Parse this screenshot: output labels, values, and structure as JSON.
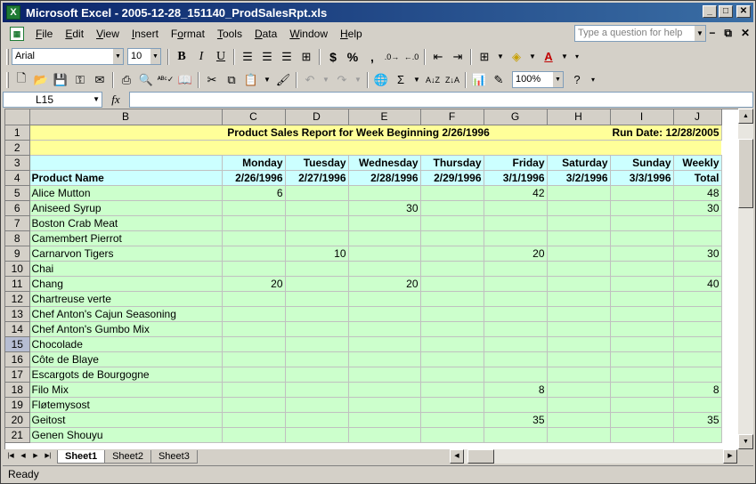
{
  "window": {
    "title": "Microsoft Excel - 2005-12-28_151140_ProdSalesRpt.xls",
    "app_icon": "X"
  },
  "menu": {
    "items": [
      {
        "u": "F",
        "rest": "ile"
      },
      {
        "u": "E",
        "rest": "dit"
      },
      {
        "u": "V",
        "rest": "iew"
      },
      {
        "u": "I",
        "rest": "nsert"
      },
      {
        "pre": "F",
        "u": "o",
        "rest": "rmat"
      },
      {
        "u": "T",
        "rest": "ools"
      },
      {
        "u": "D",
        "rest": "ata"
      },
      {
        "u": "W",
        "rest": "indow"
      },
      {
        "u": "H",
        "rest": "elp"
      }
    ],
    "help_placeholder": "Type a question for help"
  },
  "toolbar": {
    "font_name": "Arial",
    "font_size": "10",
    "bold": "B",
    "italic": "I",
    "underline": "U",
    "currency": "$",
    "percent": "%",
    "comma": ",",
    "zoom": "100%"
  },
  "formula_bar": {
    "name_box": "L15",
    "fx": "fx",
    "content": ""
  },
  "grid": {
    "columns": [
      "B",
      "C",
      "D",
      "E",
      "F",
      "G",
      "H",
      "I",
      "J"
    ],
    "report_title": "Product Sales Report for Week Beginning 2/26/1996",
    "run_date": "Run Date: 12/28/2005",
    "days": [
      "Monday",
      "Tuesday",
      "Wednesday",
      "Thursday",
      "Friday",
      "Saturday",
      "Sunday",
      "Weekly"
    ],
    "product_header": "Product Name",
    "dates": [
      "2/26/1996",
      "2/27/1996",
      "2/28/1996",
      "2/29/1996",
      "3/1/1996",
      "3/2/1996",
      "3/3/1996",
      "Total"
    ],
    "rows": [
      {
        "n": "5",
        "name": "Alice Mutton",
        "v": [
          "6",
          "",
          "",
          "",
          "42",
          "",
          "",
          "48"
        ]
      },
      {
        "n": "6",
        "name": "Aniseed Syrup",
        "v": [
          "",
          "",
          "30",
          "",
          "",
          "",
          "",
          "30"
        ]
      },
      {
        "n": "7",
        "name": "Boston Crab Meat",
        "v": [
          "",
          "",
          "",
          "",
          "",
          "",
          "",
          ""
        ]
      },
      {
        "n": "8",
        "name": "Camembert Pierrot",
        "v": [
          "",
          "",
          "",
          "",
          "",
          "",
          "",
          ""
        ]
      },
      {
        "n": "9",
        "name": "Carnarvon Tigers",
        "v": [
          "",
          "10",
          "",
          "",
          "20",
          "",
          "",
          "30"
        ]
      },
      {
        "n": "10",
        "name": "Chai",
        "v": [
          "",
          "",
          "",
          "",
          "",
          "",
          "",
          ""
        ]
      },
      {
        "n": "11",
        "name": "Chang",
        "v": [
          "20",
          "",
          "20",
          "",
          "",
          "",
          "",
          "40"
        ]
      },
      {
        "n": "12",
        "name": "Chartreuse verte",
        "v": [
          "",
          "",
          "",
          "",
          "",
          "",
          "",
          ""
        ]
      },
      {
        "n": "13",
        "name": "Chef Anton's Cajun Seasoning",
        "v": [
          "",
          "",
          "",
          "",
          "",
          "",
          "",
          ""
        ]
      },
      {
        "n": "14",
        "name": "Chef Anton's Gumbo Mix",
        "v": [
          "",
          "",
          "",
          "",
          "",
          "",
          "",
          ""
        ]
      },
      {
        "n": "15",
        "name": "Chocolade",
        "v": [
          "",
          "",
          "",
          "",
          "",
          "",
          "",
          ""
        ]
      },
      {
        "n": "16",
        "name": "Côte de Blaye",
        "v": [
          "",
          "",
          "",
          "",
          "",
          "",
          "",
          ""
        ]
      },
      {
        "n": "17",
        "name": "Escargots de Bourgogne",
        "v": [
          "",
          "",
          "",
          "",
          "",
          "",
          "",
          ""
        ]
      },
      {
        "n": "18",
        "name": "Filo Mix",
        "v": [
          "",
          "",
          "",
          "",
          "8",
          "",
          "",
          "8"
        ]
      },
      {
        "n": "19",
        "name": "Fløtemysost",
        "v": [
          "",
          "",
          "",
          "",
          "",
          "",
          "",
          ""
        ]
      },
      {
        "n": "20",
        "name": "Geitost",
        "v": [
          "",
          "",
          "",
          "",
          "35",
          "",
          "",
          "35"
        ]
      },
      {
        "n": "21",
        "name": "Genen Shouyu",
        "v": [
          "",
          "",
          "",
          "",
          "",
          "",
          "",
          ""
        ]
      }
    ],
    "selected_row": "15"
  },
  "sheets": [
    "Sheet1",
    "Sheet2",
    "Sheet3"
  ],
  "active_sheet": "Sheet1",
  "status": "Ready",
  "colors": {
    "title_fill": "#ffff99",
    "header_fill": "#ccffff",
    "body_fill": "#ccffcc",
    "titlebar": "#0a246a"
  }
}
